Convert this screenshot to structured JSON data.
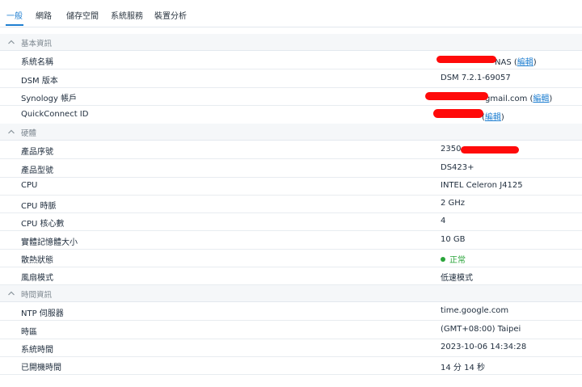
{
  "tabs": [
    "一般",
    "網路",
    "儲存空間",
    "系統服務",
    "裝置分析"
  ],
  "sections": {
    "basic": "基本資訊",
    "hardware": "硬體",
    "time": "時間資訊"
  },
  "basic": {
    "system_name_label": "系統名稱",
    "system_name_value": "NAS",
    "dsm_label": "DSM 版本",
    "dsm_value": "DSM 7.2.1-69057",
    "synology_label": "Synology 帳戶",
    "synology_value": "gmail.com",
    "quickconnect_label": "QuickConnect ID",
    "edit_label": "編輯"
  },
  "hardware": {
    "serial_label": "產品序號",
    "serial_value": "2350",
    "model_label": "產品型號",
    "model_value": "DS423+",
    "cpu_label": "CPU",
    "cpu_value": "INTEL Celeron J4125",
    "cpu_freq_label": "CPU 時脈",
    "cpu_freq_value": "2 GHz",
    "cpu_cores_label": "CPU 核心數",
    "cpu_cores_value": "4",
    "memory_label": "實體記憶體大小",
    "memory_value": "10 GB",
    "thermal_label": "散熱狀態",
    "thermal_value": "正常",
    "fan_label": "風扇模式",
    "fan_value": "低速模式"
  },
  "time": {
    "ntp_label": "NTP 伺服器",
    "ntp_value": "time.google.com",
    "timezone_label": "時區",
    "timezone_value": "(GMT+08:00) Taipei",
    "system_time_label": "系統時間",
    "system_time_value": "2023-10-06 14:34:28",
    "uptime_label": "已開機時間",
    "uptime_value": "14 分 14 秒"
  },
  "colors": {
    "accent": "#1f7fd1",
    "status_ok": "#2aa43a",
    "redaction": "#ff0a0a"
  },
  "icons": {
    "section_toggle": "chevron-up-icon",
    "status": "status-dot-icon"
  }
}
